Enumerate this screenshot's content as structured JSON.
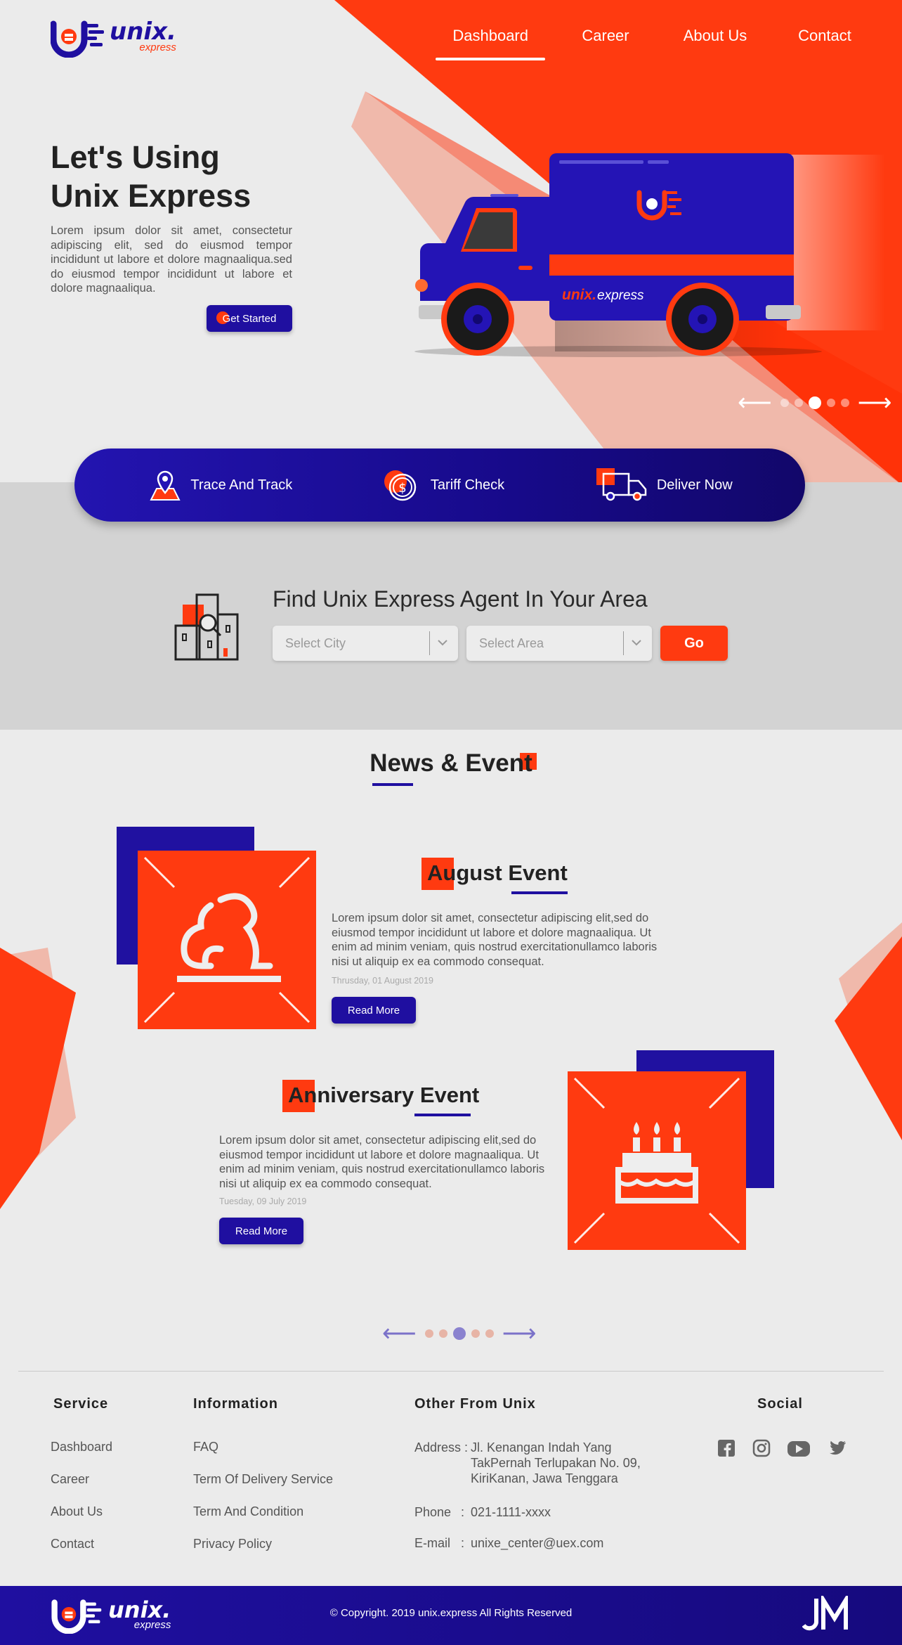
{
  "brand": {
    "name": "unix.",
    "sub": "express",
    "footer_name": "unix.",
    "footer_sub": "express"
  },
  "nav": [
    {
      "label": "Dashboard",
      "active": true
    },
    {
      "label": "Career"
    },
    {
      "label": "About Us"
    },
    {
      "label": "Contact"
    }
  ],
  "hero": {
    "title_line1": "Let's Using",
    "title_line2": "Unix Express",
    "description": "Lorem ipsum dolor sit amet, consectetur adipiscing elit, sed do eiusmod tempor incididunt ut labore et dolore magnaaliqua.sed do eiusmod tempor incididunt ut labore et dolore magnaaliqua.",
    "cta": "Get Started",
    "truck_brand": "unix.",
    "truck_brand_sub": "express",
    "slide_index": 3,
    "slide_count": 5
  },
  "services": [
    {
      "label": "Trace And Track",
      "icon": "map-pin-icon"
    },
    {
      "label": "Tariff Check",
      "icon": "dollar-coin-icon"
    },
    {
      "label": "Deliver Now",
      "icon": "delivery-truck-icon"
    }
  ],
  "agent": {
    "title": "Find Unix Express Agent In Your Area",
    "city_placeholder": "Select City",
    "area_placeholder": "Select Area",
    "go": "Go"
  },
  "news": {
    "title": "News & Event",
    "events": [
      {
        "title": "August Event",
        "description": "Lorem ipsum dolor sit amet, consectetur adipiscing elit,sed do eiusmod tempor incididunt ut labore et dolore magnaaliqua. Ut enim ad minim veniam, quis nostrud exercitationullamco laboris nisi ut aliquip ex ea commodo consequat.",
        "date": "Thrusday, 01 August 2019",
        "button": "Read More",
        "icon": "dog-icon"
      },
      {
        "title": "Anniversary Event",
        "description": "Lorem ipsum dolor sit amet, consectetur adipiscing elit,sed do eiusmod tempor incididunt ut labore et dolore magnaaliqua. Ut enim ad minim veniam, quis nostrud exercitationullamco laboris nisi ut aliquip ex ea commodo consequat.",
        "date": "Tuesday, 09 July 2019",
        "button": "Read More",
        "icon": "birthday-cake-icon"
      }
    ],
    "slide_index": 3,
    "slide_count": 5
  },
  "footer": {
    "service": {
      "title": "Service",
      "links": [
        "Dashboard",
        "Career",
        "About Us",
        "Contact"
      ]
    },
    "information": {
      "title": "Information",
      "links": [
        "FAQ",
        "Term Of Delivery Service",
        "Term And Condition",
        "Privacy Policy"
      ]
    },
    "other": {
      "title": "Other From Unix",
      "address_label": "Address :",
      "address_l1": "Jl. Kenangan Indah Yang",
      "address_l2": "TakPernah Terlupakan No. 09,",
      "address_l3": "KiriKanan, Jawa Tenggara",
      "phone_label": "Phone",
      "phone_colon": ":",
      "phone": "021-1111-xxxx",
      "email_label": "E-mail",
      "email_colon": ":",
      "email": "unixe_center@uex.com"
    },
    "social": {
      "title": "Social",
      "icons": [
        "facebook-icon",
        "instagram-icon",
        "youtube-icon",
        "twitter-icon"
      ]
    },
    "copyright": "Copyright. 2019 unix.express All Rights Reserved"
  },
  "colors": {
    "primary": "#1f0fa0",
    "accent": "#ff3a10",
    "background": "#ebebeb",
    "band": "#d3d3d3"
  }
}
